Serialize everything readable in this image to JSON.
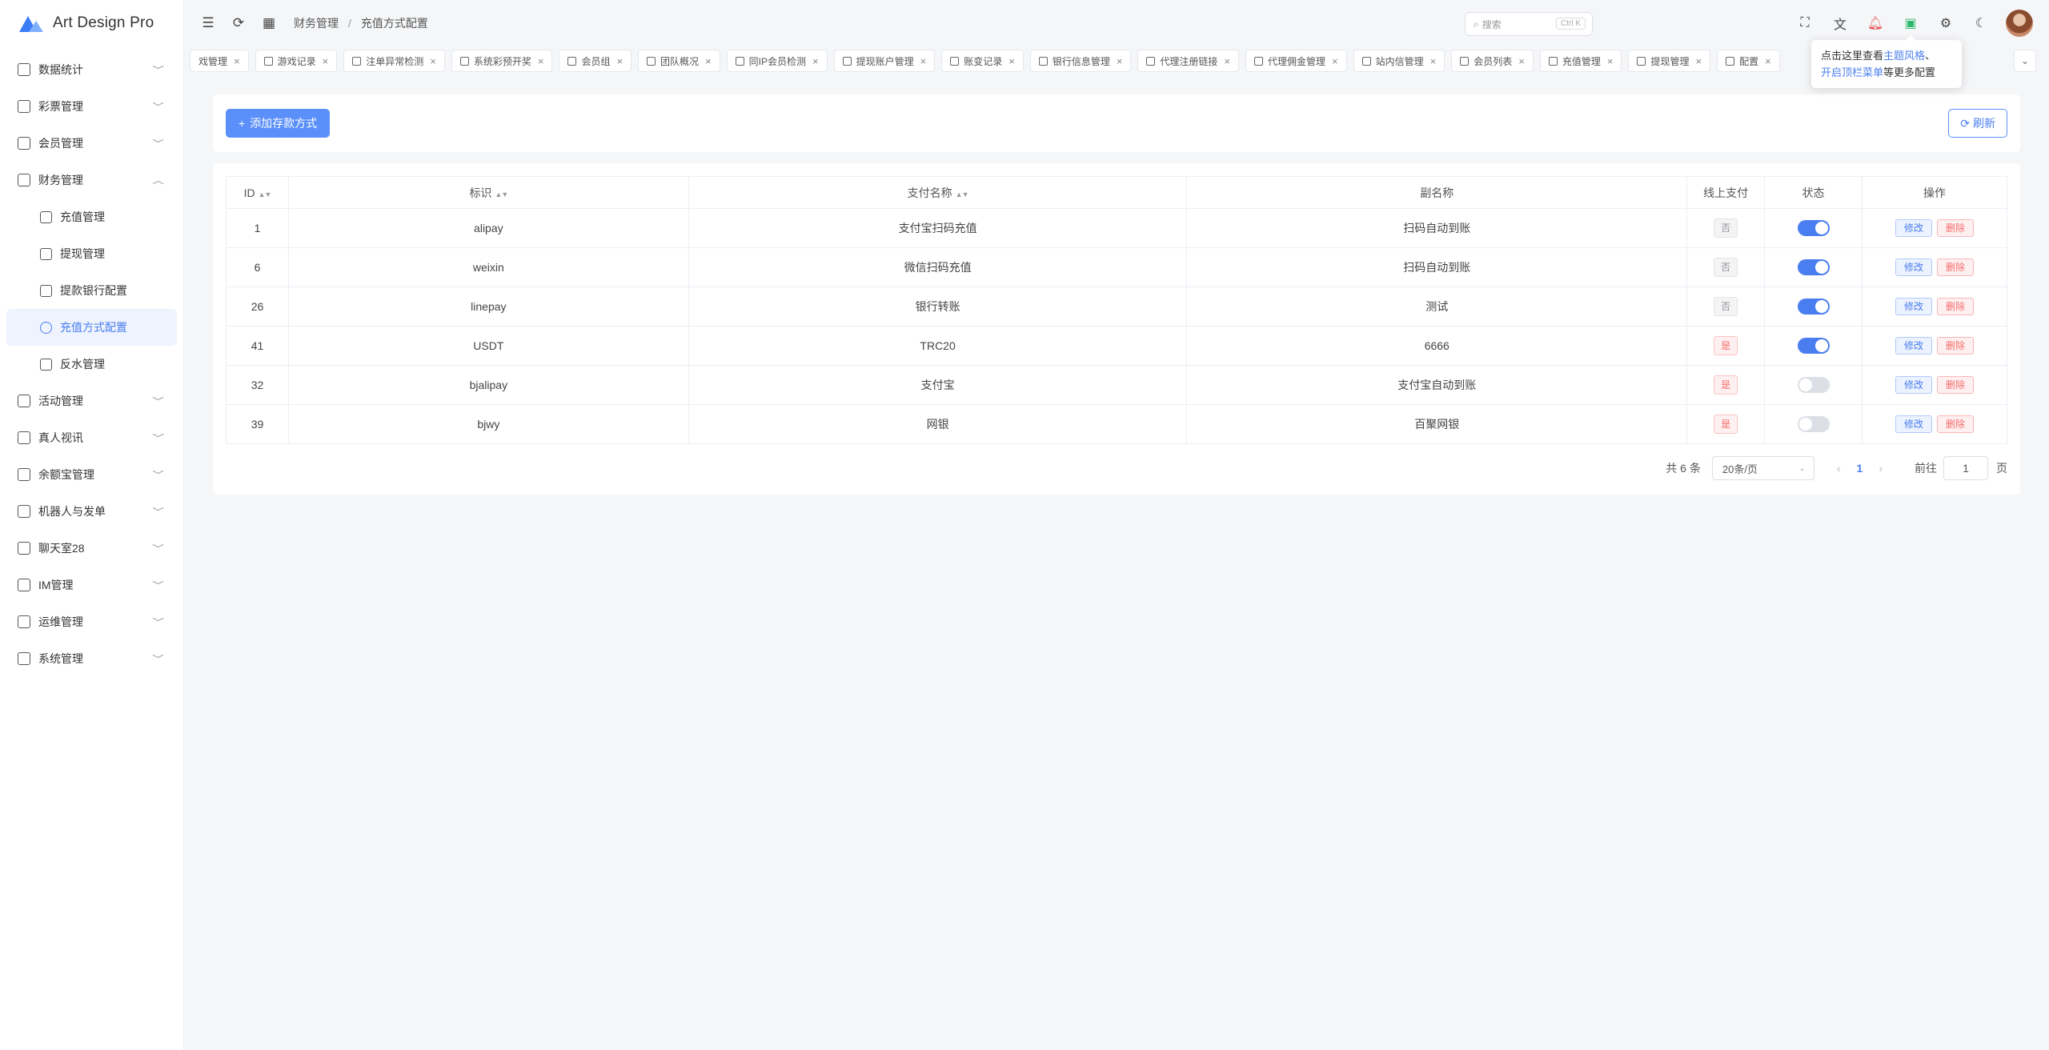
{
  "app": {
    "title": "Art Design Pro"
  },
  "sidebar": {
    "items": [
      {
        "label": "数据统计",
        "icon": "chart-icon"
      },
      {
        "label": "彩票管理",
        "icon": "ticket-icon"
      },
      {
        "label": "会员管理",
        "icon": "user-icon"
      },
      {
        "label": "财务管理",
        "icon": "wallet-icon",
        "expanded": true
      },
      {
        "label": "活动管理",
        "icon": "gift-icon"
      },
      {
        "label": "真人视讯",
        "icon": "video-icon"
      },
      {
        "label": "余额宝管理",
        "icon": "safe-icon"
      },
      {
        "label": "机器人与发单",
        "icon": "robot-icon"
      },
      {
        "label": "聊天室28",
        "icon": "chat-icon"
      },
      {
        "label": "IM管理",
        "icon": "message-icon"
      },
      {
        "label": "运维管理",
        "icon": "tools-icon"
      },
      {
        "label": "系统管理",
        "icon": "user-icon"
      }
    ],
    "finance_sub": [
      {
        "label": "充值管理",
        "icon": "coins-icon"
      },
      {
        "label": "提现管理",
        "icon": "card-icon"
      },
      {
        "label": "提款银行配置",
        "icon": "bank-icon"
      },
      {
        "label": "充值方式配置",
        "icon": "gear-icon",
        "active": true
      },
      {
        "label": "反水管理",
        "icon": "refund-icon"
      }
    ]
  },
  "header": {
    "breadcrumb": [
      "财务管理",
      "充值方式配置"
    ],
    "search_placeholder": "搜索",
    "search_shortcut": "Ctrl K"
  },
  "tabs": [
    "戏管理",
    "游戏记录",
    "注单异常检测",
    "系统彩预开奖",
    "会员组",
    "团队概况",
    "同IP会员检测",
    "提现账户管理",
    "账变记录",
    "银行信息管理",
    "代理注册链接",
    "代理佣金管理",
    "站内信管理",
    "会员列表",
    "充值管理",
    "提现管理",
    "配置"
  ],
  "tooltip": {
    "line1_prefix": "点击这里查看",
    "line1_link": "主题风格",
    "line1_suffix": "、",
    "line2_link": "开启顶栏菜单",
    "line2_suffix": "等更多配置"
  },
  "toolbar": {
    "add_label": "添加存款方式",
    "refresh_label": "刷新"
  },
  "table": {
    "headers": [
      "ID",
      "标识",
      "支付名称",
      "副名称",
      "线上支付",
      "状态",
      "操作"
    ],
    "rows": [
      {
        "id": "1",
        "code": "alipay",
        "name": "支付宝扫码充值",
        "subname": "扫码自动到账",
        "online": "否",
        "status": true
      },
      {
        "id": "6",
        "code": "weixin",
        "name": "微信扫码充值",
        "subname": "扫码自动到账",
        "online": "否",
        "status": true
      },
      {
        "id": "26",
        "code": "linepay",
        "name": "银行转账",
        "subname": "测试",
        "online": "否",
        "status": true
      },
      {
        "id": "41",
        "code": "USDT",
        "name": "TRC20",
        "subname": "6666",
        "online": "是",
        "status": true
      },
      {
        "id": "32",
        "code": "bjalipay",
        "name": "支付宝",
        "subname": "支付宝自动到账",
        "online": "是",
        "status": false
      },
      {
        "id": "39",
        "code": "bjwy",
        "name": "网银",
        "subname": "百聚网银",
        "online": "是",
        "status": false
      }
    ],
    "edit_label": "修改",
    "delete_label": "删除"
  },
  "pagination": {
    "total_text": "共 6 条",
    "page_size": "20条/页",
    "current_page": "1",
    "goto_label": "前往",
    "goto_value": "1",
    "page_unit": "页"
  },
  "colors": {
    "accent": "#4a7ef0",
    "danger": "#f56c6c"
  }
}
